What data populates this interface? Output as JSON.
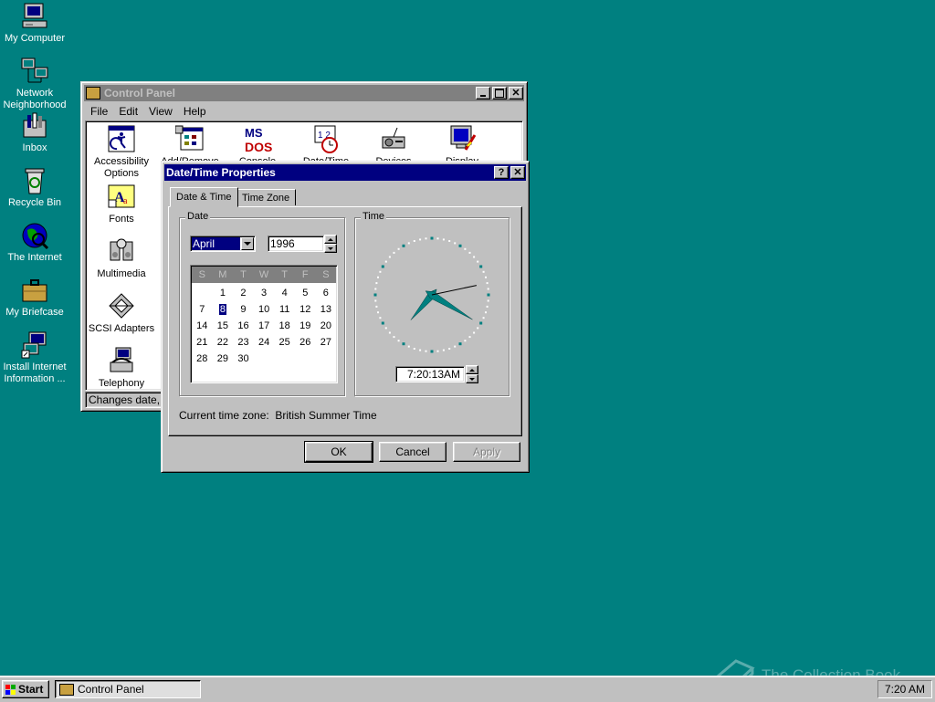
{
  "desktop": {
    "icons": [
      {
        "label_1": "My Computer",
        "label_2": ""
      },
      {
        "label_1": "Network",
        "label_2": "Neighborhood"
      },
      {
        "label_1": "Inbox",
        "label_2": ""
      },
      {
        "label_1": "Recycle Bin",
        "label_2": ""
      },
      {
        "label_1": "The Internet",
        "label_2": ""
      },
      {
        "label_1": "My Briefcase",
        "label_2": ""
      },
      {
        "label_1": "Install Internet",
        "label_2": "Information ..."
      }
    ],
    "watermark": "The Collection Book"
  },
  "control_panel": {
    "title": "Control Panel",
    "menu": [
      "File",
      "Edit",
      "View",
      "Help"
    ],
    "items": [
      {
        "label_1": "Accessibility",
        "label_2": "Options"
      },
      {
        "label_1": "Add/Remove",
        "label_2": ""
      },
      {
        "label_1": "Console",
        "label_2": ""
      },
      {
        "label_1": "Date/Time",
        "label_2": ""
      },
      {
        "label_1": "Devices",
        "label_2": ""
      },
      {
        "label_1": "Display",
        "label_2": ""
      },
      {
        "label_1": "Fonts",
        "label_2": ""
      },
      {
        "label_1": "Multimedia",
        "label_2": ""
      },
      {
        "label_1": "SCSI Adapters",
        "label_2": ""
      },
      {
        "label_1": "Telephony",
        "label_2": ""
      }
    ],
    "status": "Changes date, tir"
  },
  "dialog": {
    "title": "Date/Time Properties",
    "help_button": "?",
    "close_button": "✕",
    "tabs": [
      "Date & Time",
      "Time Zone"
    ],
    "date_group_label": "Date",
    "time_group_label": "Time",
    "month": "April",
    "year": "1996",
    "weekdays": [
      "S",
      "M",
      "T",
      "W",
      "T",
      "F",
      "S"
    ],
    "calendar_weeks": [
      [
        "",
        "1",
        "2",
        "3",
        "4",
        "5",
        "6"
      ],
      [
        "7",
        "8",
        "9",
        "10",
        "11",
        "12",
        "13"
      ],
      [
        "14",
        "15",
        "16",
        "17",
        "18",
        "19",
        "20"
      ],
      [
        "21",
        "22",
        "23",
        "24",
        "25",
        "26",
        "27"
      ],
      [
        "28",
        "29",
        "30",
        "",
        "",
        "",
        ""
      ]
    ],
    "selected_day": "8",
    "time_value": "7:20:13AM",
    "clock": {
      "hour": 7,
      "minute": 20,
      "second": 13,
      "hand_color": "#008080"
    },
    "timezone_text": "Current time zone:  British Summer Time",
    "buttons": {
      "ok": "OK",
      "cancel": "Cancel",
      "apply": "Apply"
    }
  },
  "taskbar": {
    "start_label": "Start",
    "task_label": "Control Panel",
    "clock": "7:20 AM"
  },
  "colors": {
    "desktop": "#008080",
    "title_active": "#000080",
    "title_inactive": "#808080",
    "face": "#c0c0c0"
  }
}
